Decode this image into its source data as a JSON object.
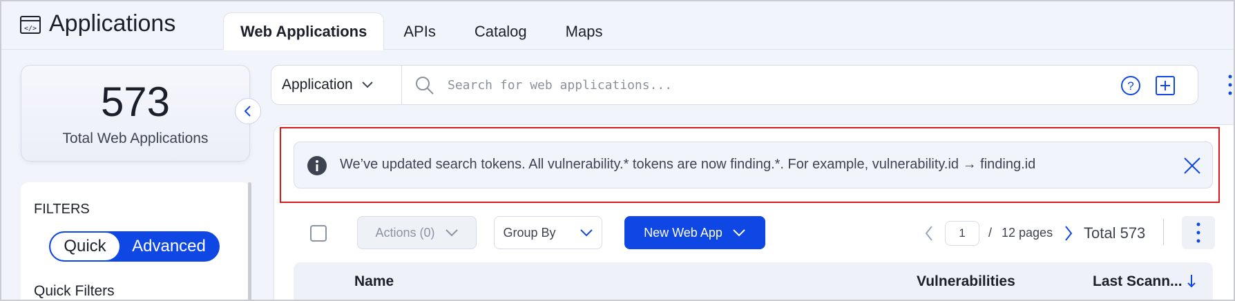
{
  "header": {
    "title": "Applications",
    "tabs": [
      {
        "label": "Web Applications",
        "active": true
      },
      {
        "label": "APIs",
        "active": false
      },
      {
        "label": "Catalog",
        "active": false
      },
      {
        "label": "Maps",
        "active": false
      }
    ]
  },
  "summary": {
    "count": "573",
    "label": "Total Web Applications"
  },
  "filters": {
    "title": "FILTERS",
    "toggle": {
      "quick": "Quick",
      "advanced": "Advanced",
      "selected": "Quick"
    },
    "quick_filters_title": "Quick Filters"
  },
  "search": {
    "type_label": "Application",
    "placeholder": "Search for web applications..."
  },
  "banner": {
    "text": "We’ve updated search tokens. All vulnerability.* tokens are now finding.*. For example, vulnerability.id → finding.id"
  },
  "toolbar": {
    "actions_label": "Actions (0)",
    "group_by_label": "Group By",
    "new_label": "New Web App",
    "page_value": "1",
    "page_separator": "/",
    "pages_label": "12 pages",
    "total_label": "Total 573"
  },
  "table": {
    "columns": [
      "Name",
      "Vulnerabilities",
      "Last Scann..."
    ]
  },
  "colors": {
    "accent": "#0f47e4",
    "highlight": "#d7191c",
    "background": "#f1f4fa"
  }
}
